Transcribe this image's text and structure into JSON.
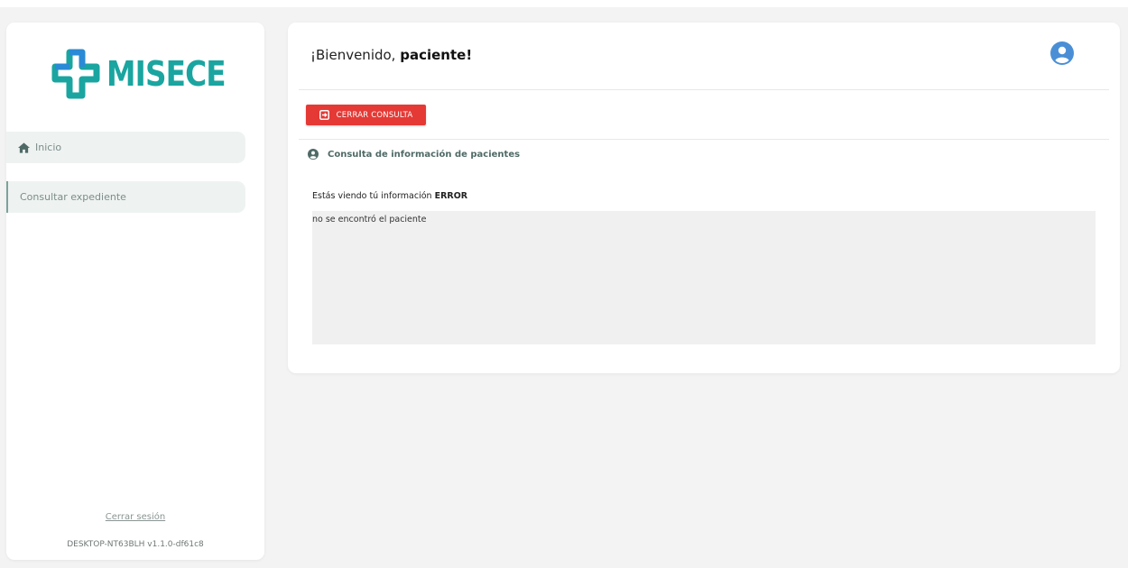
{
  "sidebar": {
    "logo_text": "MISECE",
    "nav": [
      {
        "label": "Inicio",
        "icon": "home-icon"
      },
      {
        "label": "Consultar expediente"
      }
    ],
    "logout_label": "Cerrar sesión",
    "version": "DESKTOP-NT63BLH v1.1.0-df61c8"
  },
  "header": {
    "greeting_prefix": "¡Bienvenido, ",
    "greeting_user": "paciente!",
    "avatar_icon": "user-circle-icon"
  },
  "main": {
    "close_button_label": "CERRAR CONSULTA",
    "close_button_icon": "sign-out-box-icon",
    "section_title": "Consulta de información de pacientes",
    "section_icon": "user-circle-icon",
    "info_prefix": "Estás viendo tú información ",
    "info_status": "ERROR",
    "result_text": "no se encontró el paciente"
  },
  "colors": {
    "brand": "#1aa5a0",
    "danger": "#e53935",
    "avatar": "#4a8fd6",
    "section_text": "#4f6a66"
  }
}
